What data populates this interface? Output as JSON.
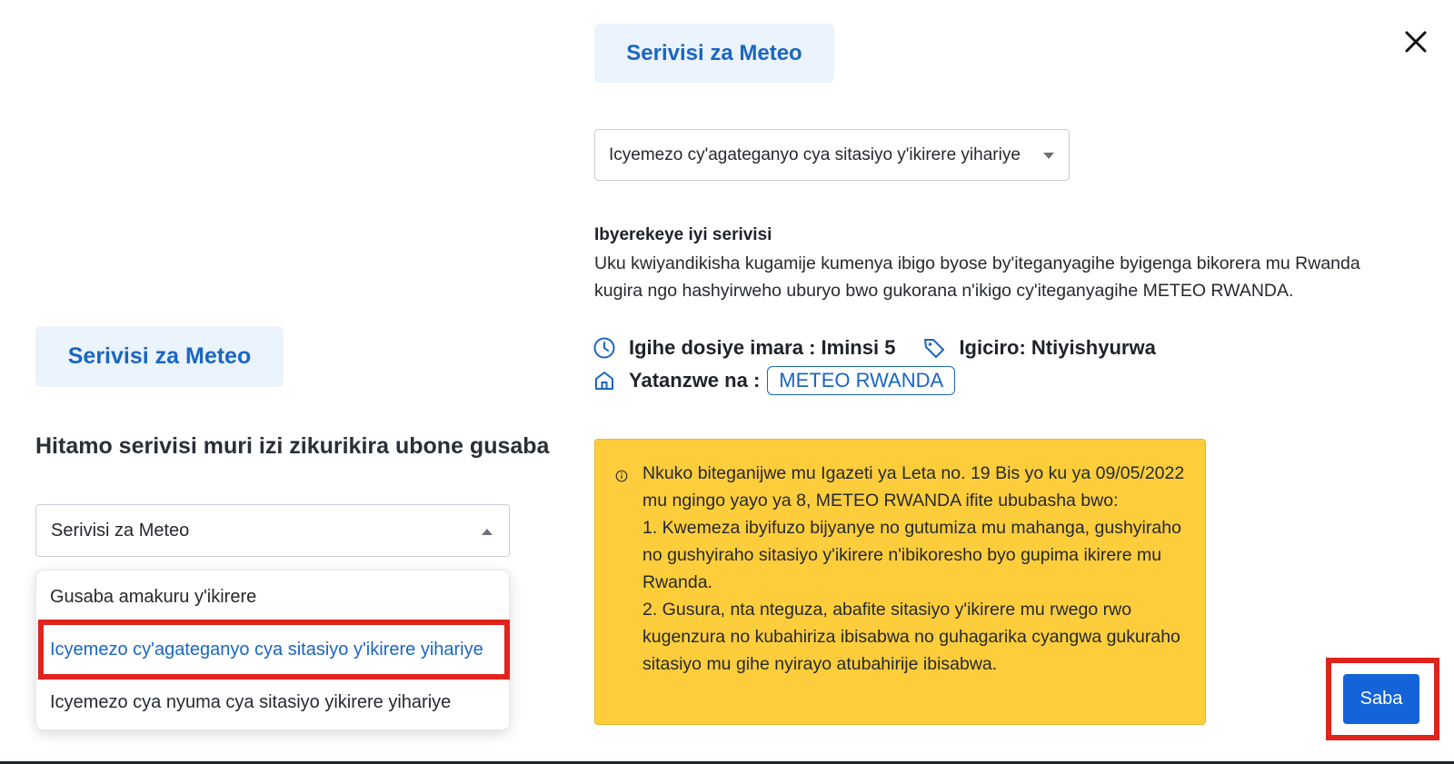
{
  "left_panel": {
    "service_tag": "Serivisi za Meteo",
    "heading": "Hitamo serivisi muri izi zikurikira ubone gusaba",
    "category_select": {
      "value": "Serivisi za Meteo"
    },
    "options": [
      "Gusaba amakuru y'ikirere",
      "Icyemezo cy'agateganyo cya sitasiyo y'ikirere yihariye",
      "Icyemezo cya nyuma cya sitasiyo yikirere yihariye"
    ]
  },
  "right_panel": {
    "service_tag": "Serivisi za Meteo",
    "service_select": {
      "value": "Icyemezo cy'agateganyo cya sitasiyo y'ikirere yihariye"
    },
    "about_title": "Ibyerekeye iyi serivisi",
    "about_text": "Uku kwiyandikisha kugamije kumenya ibigo byose by'iteganyagihe byigenga bikorera mu Rwanda kugira ngo hashyirweho uburyo bwo gukorana n'ikigo cy'iteganyagihe METEO RWANDA.",
    "processing_time": "Igihe dosiye imara : Iminsi 5",
    "price": "Igiciro: Ntiyishyurwa",
    "provided_by_label": "Yatanzwe na :",
    "provider": "METEO RWANDA",
    "notice": "Nkuko biteganijwe mu Igazeti ya Leta no. 19 Bis yo ku ya 09/05/2022 mu ngingo yayo ya 8, METEO RWANDA ifite ububasha bwo:\n1. Kwemeza ibyifuzo bijyanye no gutumiza mu mahanga, gushyiraho no gushyiraho sitasiyo y'ikirere n'ibikoresho byo gupima ikirere mu Rwanda.\n2. Gusura, nta nteguza, abafite sitasiyo y'ikirere mu rwego rwo kugenzura no kubahiriza ibisabwa no guhagarika cyangwa gukuraho sitasiyo mu gihe nyirayo atubahirije ibisabwa."
  },
  "actions": {
    "next_label": "Saba"
  },
  "icons": {
    "close": "close-icon",
    "clock": "clock-icon",
    "tag": "tag-icon",
    "home": "home-icon",
    "info": "info-icon"
  },
  "colors": {
    "accent": "#1a66c2",
    "tag_bg": "#ebf3fd",
    "notice_bg": "#fecd3b",
    "button": "#1463d8",
    "highlight": "#e0231b"
  }
}
